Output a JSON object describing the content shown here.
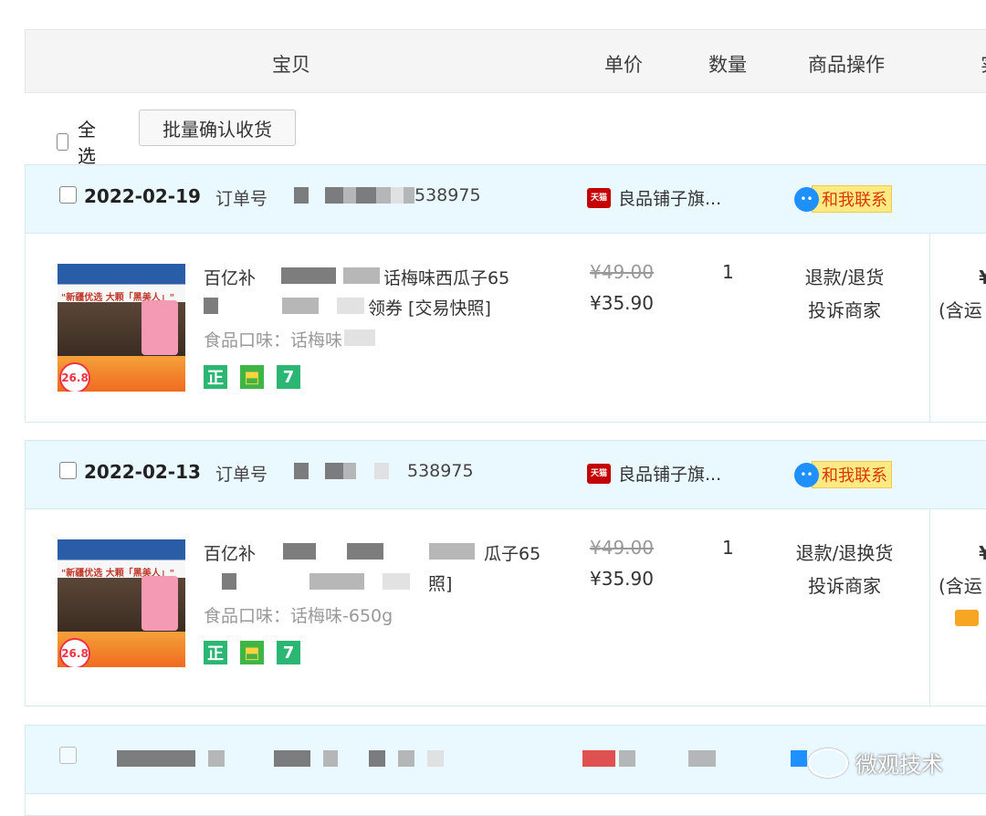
{
  "header": {
    "col_item": "宝贝",
    "col_price": "单价",
    "col_qty": "数量",
    "col_ops": "商品操作",
    "col_total": "实"
  },
  "toolbar": {
    "select_all": "全选",
    "batch_confirm": "批量确认收货"
  },
  "orders": [
    {
      "date": "2022-02-19",
      "order_label": "订单号",
      "order_no_tail": "538975",
      "shop": "良品铺子旗...",
      "contact": "和我联系",
      "product": {
        "title_line1_start": "百亿补",
        "title_line1_end": "话梅味西瓜子65",
        "title_line2_end": "领券 [交易快照]",
        "attr": "食品口味：话梅味",
        "thumb_banner": "\"新疆优选 大颗「黑美人」\"",
        "thumb_price": "26.8",
        "badges": [
          "正",
          "⬒",
          "7"
        ]
      },
      "orig_price": "¥49.00",
      "price": "¥35.90",
      "qty": "1",
      "ops": [
        "退款/退货",
        "投诉商家"
      ],
      "total": "¥",
      "total_note": "(含运"
    },
    {
      "date": "2022-02-13",
      "order_label": "订单号",
      "order_no_tail": "538975",
      "shop": "良品铺子旗...",
      "contact": "和我联系",
      "product": {
        "title_line1_start": "百亿补",
        "title_line1_end": "瓜子65",
        "title_line2_end": "照]",
        "attr": "食品口味：话梅味-650g",
        "thumb_banner": "\"新疆优选 大颗「黑美人」\"",
        "thumb_price": "26.8",
        "badges": [
          "正",
          "⬒",
          "7"
        ]
      },
      "orig_price": "¥49.00",
      "price": "¥35.90",
      "qty": "1",
      "ops": [
        "退款/退换货",
        "投诉商家"
      ],
      "total": "¥",
      "total_note": "(含运"
    }
  ],
  "watermark": "微观技术",
  "colors": {
    "header_bg": "#f5f5f5",
    "order_head_bg": "#eaf8ff",
    "contact_bg": "#ffe985",
    "contact_text": "#d63a00",
    "tmall_red": "#c40000",
    "badge_green": "#2bb673"
  }
}
